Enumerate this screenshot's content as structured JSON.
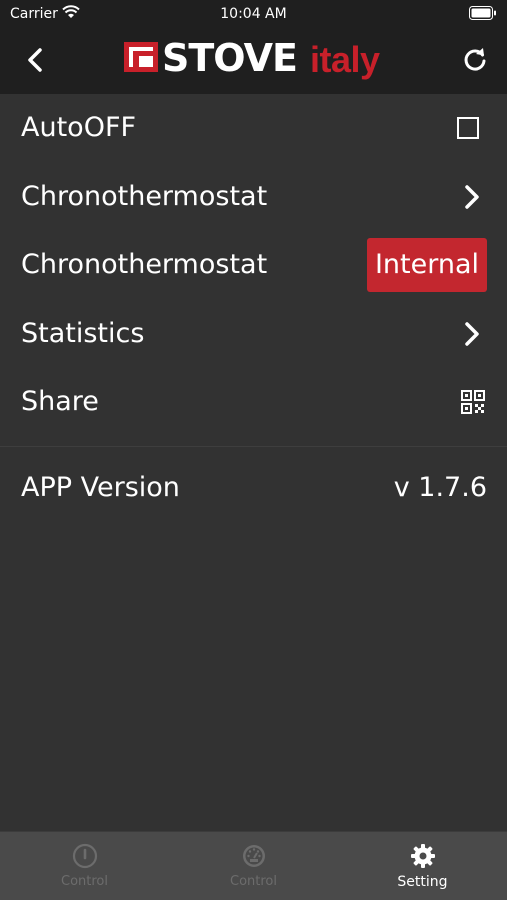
{
  "status_bar": {
    "carrier": "Carrier",
    "time": "10:04 AM"
  },
  "nav": {
    "logo_stove": "STOVE",
    "logo_italy": "italy",
    "back_icon": "chevron-left-icon",
    "refresh_icon": "refresh-icon"
  },
  "settings": {
    "items": [
      {
        "label": "AutoOFF",
        "accessory": "checkbox",
        "checked": false
      },
      {
        "label": "Chronothermostat",
        "accessory": "chevron-right-icon"
      },
      {
        "label": "Chronothermostat",
        "accessory": "badge",
        "badge": "Internal"
      },
      {
        "label": "Statistics",
        "accessory": "chevron-right-icon"
      },
      {
        "label": "Share",
        "accessory": "qr-code-icon"
      }
    ],
    "version_label": "APP Version",
    "version_value": "v 1.7.6"
  },
  "tabbar": {
    "tabs": [
      {
        "label": "Control",
        "icon": "power-icon",
        "active": false
      },
      {
        "label": "Control",
        "icon": "gauge-icon",
        "active": false
      },
      {
        "label": "Setting",
        "icon": "gear-icon",
        "active": true
      }
    ]
  },
  "colors": {
    "background": "#323232",
    "navbar": "#1f1f1f",
    "accent": "#c3272f",
    "tabbar": "#4a4a4a"
  }
}
